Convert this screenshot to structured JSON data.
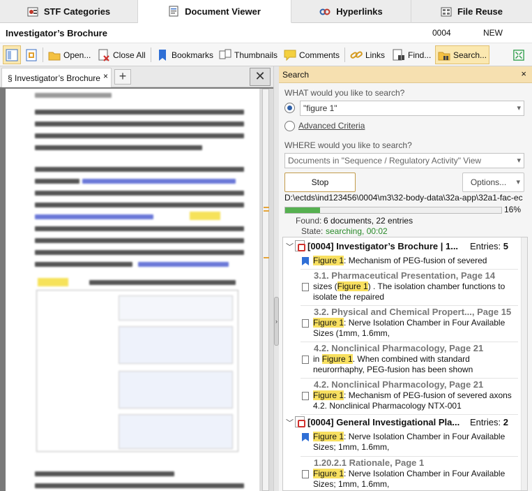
{
  "top_tabs": [
    {
      "label": "STF Categories",
      "icon": "stf-categories-icon",
      "active": false
    },
    {
      "label": "Document Viewer",
      "icon": "document-viewer-icon",
      "active": true
    },
    {
      "label": "Hyperlinks",
      "icon": "hyperlinks-icon",
      "active": false
    },
    {
      "label": "File Reuse",
      "icon": "file-reuse-icon",
      "active": false
    }
  ],
  "title_row": {
    "doc_title": "Investigator’s Brochure",
    "sequence": "0004",
    "operation": "NEW"
  },
  "toolbar": {
    "open_label": "Open...",
    "close_all_label": "Close All",
    "bookmarks_label": "Bookmarks",
    "thumbnails_label": "Thumbnails",
    "comments_label": "Comments",
    "links_label": "Links",
    "find_label": "Find...",
    "search_label": "Search..."
  },
  "doc_tab": {
    "label": "§ Investigator’s Brochure",
    "close": "×",
    "new_tab": "+",
    "pane_close": "✕"
  },
  "search": {
    "panel_title": "Search",
    "close": "×",
    "what_label": "WHAT would you like to search?",
    "query": "\"figure 1\"",
    "advanced_label": "Advanced Criteria",
    "where_label": "WHERE would you like to search?",
    "where_value": "Documents in \"Sequence / Regulatory Activity\" View",
    "stop_label": "Stop",
    "options_label": "Options...",
    "current_path": "D:\\ectds\\ind123456\\0004\\m3\\32-body-data\\32a-app\\32a1-fac-ec",
    "progress_percent": 16,
    "progress_text": "16%",
    "found_label": "Found:",
    "found_value": "6 documents, 22 entries",
    "state_label": "State:",
    "state_value": "searching, 00:02"
  },
  "results": [
    {
      "title": "[0004] Investigator’s Brochure | 1...",
      "entries_label": "Entries:",
      "entries_count": "5",
      "items": [
        {
          "heading": "",
          "icon": "bookmark-icon",
          "pre": "",
          "match": "Figure 1",
          "post": ": Mechanism of PEG-fusion of severed"
        },
        {
          "heading": "3.1. Pharmaceutical Presentation, Page 14",
          "icon": "page-icon",
          "pre": "sizes (",
          "match": "Figure 1",
          "post": ") . The isolation chamber functions to isolate the repaired"
        },
        {
          "heading": "3.2. Physical and Chemical Propert..., Page 15",
          "icon": "page-icon",
          "pre": "",
          "match": "Figure 1",
          "post": ":  Nerve Isolation Chamber in Four Available Sizes (1mm, 1.6mm,"
        },
        {
          "heading": "4.2. Nonclinical Pharmacology, Page 21",
          "icon": "page-icon",
          "pre": "in ",
          "match": "Figure 1",
          "post": ". When combined with standard neurorrhaphy, PEG-fusion has been shown"
        },
        {
          "heading": "4.2. Nonclinical Pharmacology, Page 21",
          "icon": "page-icon",
          "pre": "",
          "match": "Figure 1",
          "post": ":     Mechanism of PEG-fusion of severed axons  4.2.     Nonclinical Pharmacology NTX-001"
        }
      ]
    },
    {
      "title": "[0004] General Investigational Pla...",
      "entries_label": "Entries:",
      "entries_count": "2",
      "items": [
        {
          "heading": "",
          "icon": "bookmark-icon",
          "pre": "",
          "match": "Figure 1",
          "post": ": Nerve Isolation Chamber in Four Available Sizes; 1mm, 1.6mm,"
        },
        {
          "heading": "1.20.2.1 Rationale, Page 1",
          "icon": "page-icon",
          "pre": "",
          "match": "Figure 1",
          "post": ":  Nerve Isolation Chamber in Four Available Sizes; 1mm, 1.6mm,"
        }
      ]
    }
  ]
}
